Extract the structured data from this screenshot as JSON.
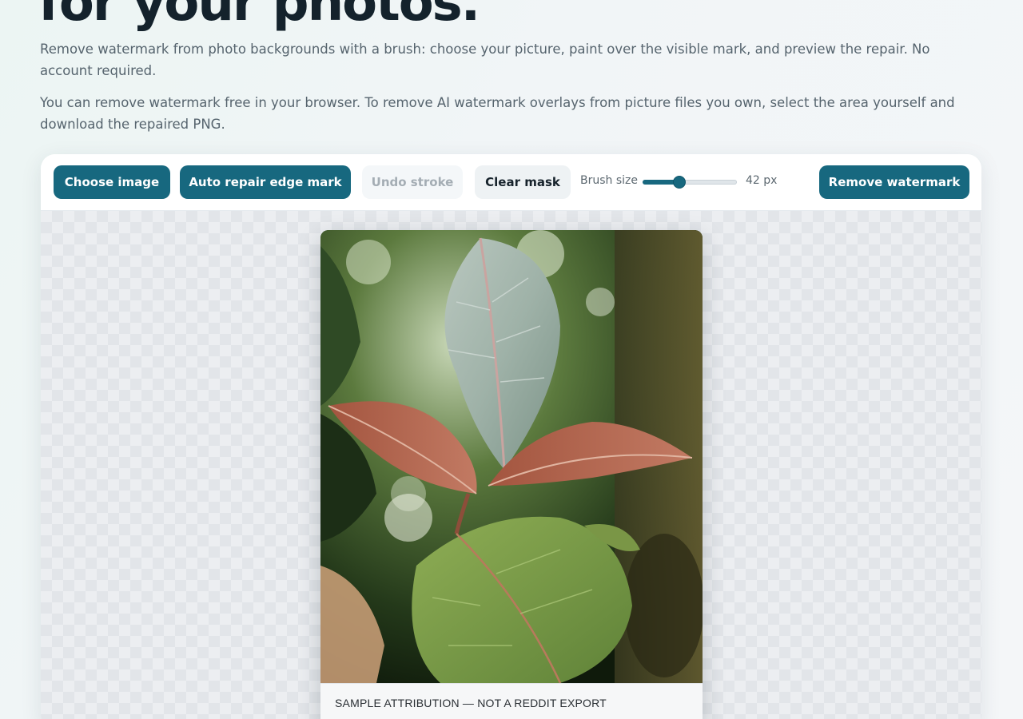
{
  "hero": {
    "title": "for your photos."
  },
  "intro": {
    "paragraph_1": "Remove watermark from photo backgrounds with a brush: choose your picture, paint over the visible mark, and preview the repair. No account required.",
    "paragraph_2": "You can remove watermark free in your browser. To remove AI watermark overlays from picture files you own, select the area yourself and download the repaired PNG."
  },
  "toolbar": {
    "choose_label": "Choose image",
    "auto_repair_label": "Auto repair edge mark",
    "undo_label": "Undo stroke",
    "clear_label": "Clear mask",
    "brush_size_label": "Brush size",
    "brush_size_value": "42 px",
    "brush_size_fraction": 0.38,
    "remove_label": "Remove watermark"
  },
  "preview": {
    "attribution": "SAMPLE ATTRIBUTION — NOT A REDDIT EXPORT"
  },
  "colors": {
    "accent": "#17687f",
    "title": "#14222c",
    "body_text": "#56646e"
  }
}
